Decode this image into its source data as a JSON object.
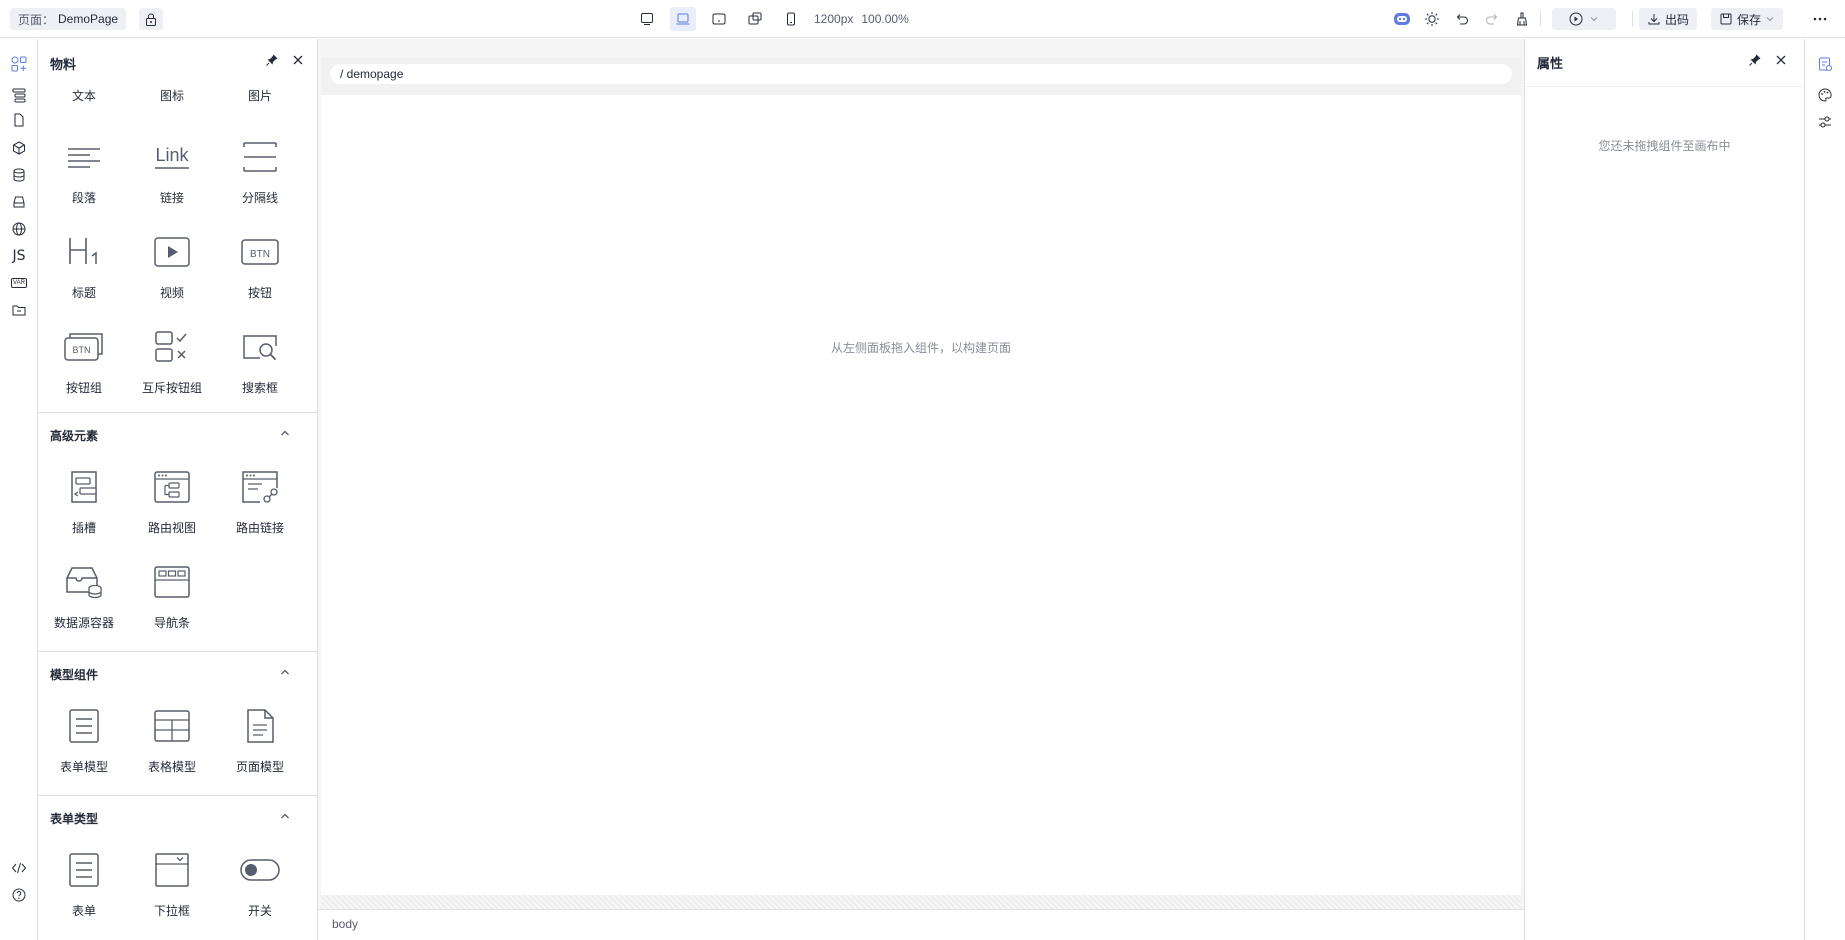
{
  "topbar": {
    "page_label": "页面：",
    "page_name": "DemoPage",
    "width_readout": "1200px",
    "zoom_readout": "100.00%",
    "publish_label": "出码",
    "save_label": "保存"
  },
  "materials": {
    "title": "物料",
    "basic_top": [
      {
        "name": "文本",
        "icon": "text-icon"
      },
      {
        "name": "图标",
        "icon": "icon-icon"
      },
      {
        "name": "图片",
        "icon": "image-icon"
      }
    ],
    "basic": [
      {
        "name": "段落",
        "icon": "paragraph-icon"
      },
      {
        "name": "链接",
        "icon": "link-icon"
      },
      {
        "name": "分隔线",
        "icon": "divider-icon"
      },
      {
        "name": "标题",
        "icon": "heading-icon"
      },
      {
        "name": "视频",
        "icon": "video-icon"
      },
      {
        "name": "按钮",
        "icon": "button-icon"
      },
      {
        "name": "按钮组",
        "icon": "button-group-icon"
      },
      {
        "name": "互斥按钮组",
        "icon": "exclusive-button-group-icon"
      },
      {
        "name": "搜索框",
        "icon": "search-box-icon"
      }
    ],
    "sections": [
      {
        "title": "高级元素",
        "items": [
          {
            "name": "插槽",
            "icon": "slot-icon"
          },
          {
            "name": "路由视图",
            "icon": "router-view-icon"
          },
          {
            "name": "路由链接",
            "icon": "router-link-icon"
          },
          {
            "name": "数据源容器",
            "icon": "datasource-container-icon"
          },
          {
            "name": "导航条",
            "icon": "navbar-icon"
          }
        ]
      },
      {
        "title": "模型组件",
        "items": [
          {
            "name": "表单模型",
            "icon": "form-model-icon"
          },
          {
            "name": "表格模型",
            "icon": "table-model-icon"
          },
          {
            "name": "页面模型",
            "icon": "page-model-icon"
          }
        ]
      },
      {
        "title": "表单类型",
        "items": [
          {
            "name": "表单",
            "icon": "form-icon"
          },
          {
            "name": "下拉框",
            "icon": "select-icon"
          },
          {
            "name": "开关",
            "icon": "switch-icon"
          }
        ]
      }
    ]
  },
  "canvas": {
    "breadcrumb": "/ demopage",
    "empty_hint": "从左侧面板拖入组件，以构建页面",
    "footer": "body"
  },
  "props": {
    "title": "属性",
    "empty_hint": "您还未拖拽组件至画布中"
  },
  "left_rail": {
    "js_label": "JS",
    "var_label": "VAR"
  },
  "colors": {
    "accent": "#5e7ce0",
    "border": "#dfe1e6",
    "text": "#252b3a",
    "muted": "#8a8e99"
  }
}
